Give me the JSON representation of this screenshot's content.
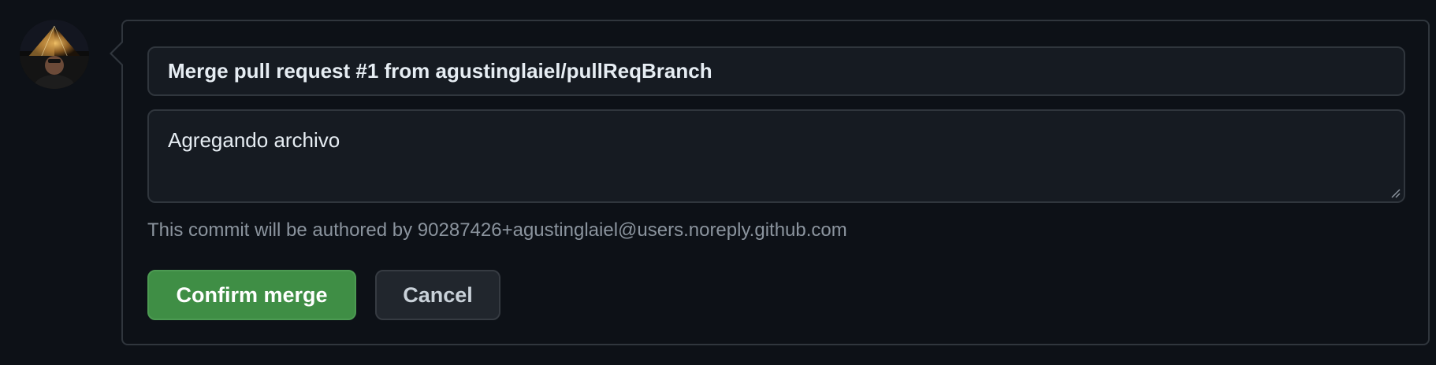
{
  "merge_form": {
    "commit_title": "Merge pull request #1 from agustinglaiel/pullReqBranch",
    "commit_body": "Agregando archivo",
    "author_note": "This commit will be authored by 90287426+agustinglaiel@users.noreply.github.com",
    "confirm_label": "Confirm merge",
    "cancel_label": "Cancel"
  },
  "icons": {
    "avatar": "user-avatar-photo",
    "resize": "resize-grip-icon"
  },
  "colors": {
    "background": "#0d1117",
    "border": "#30363d",
    "confirm_button": "#3f8e45",
    "cancel_button": "#21262d"
  }
}
